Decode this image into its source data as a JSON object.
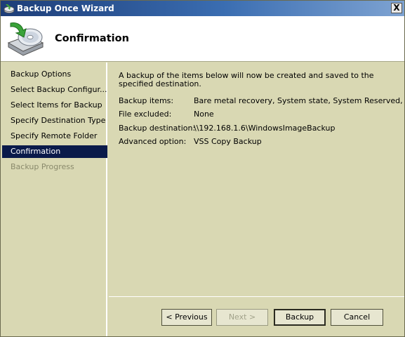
{
  "window": {
    "title": "Backup Once Wizard",
    "close_glyph": "X",
    "close_icon": "close-icon"
  },
  "header": {
    "title": "Confirmation",
    "icon": "backup-disk-icon"
  },
  "nav": {
    "items": [
      {
        "label": "Backup Options",
        "state": "normal"
      },
      {
        "label": "Select Backup Configur...",
        "state": "normal"
      },
      {
        "label": "Select Items for Backup",
        "state": "normal"
      },
      {
        "label": "Specify Destination Type",
        "state": "normal"
      },
      {
        "label": "Specify Remote Folder",
        "state": "normal"
      },
      {
        "label": "Confirmation",
        "state": "active"
      },
      {
        "label": "Backup Progress",
        "state": "disabled"
      }
    ]
  },
  "main": {
    "intro": "A backup of the items below will now be created and saved to the specified destination.",
    "details": [
      {
        "label": "Backup items:",
        "value": "Bare metal recovery, System state, System Reserved, ..."
      },
      {
        "label": "File excluded:",
        "value": "None"
      },
      {
        "label": "Backup destination:",
        "value": "\\\\192.168.1.6\\WindowsImageBackup"
      },
      {
        "label": "Advanced option:",
        "value": "VSS Copy Backup"
      }
    ]
  },
  "buttons": {
    "previous": "< Previous",
    "next": "Next >",
    "backup": "Backup",
    "cancel": "Cancel"
  },
  "colors": {
    "title_bar": "#1d3d78",
    "panel_background": "#d9d8b3",
    "nav_active": "#0a1a4a"
  }
}
